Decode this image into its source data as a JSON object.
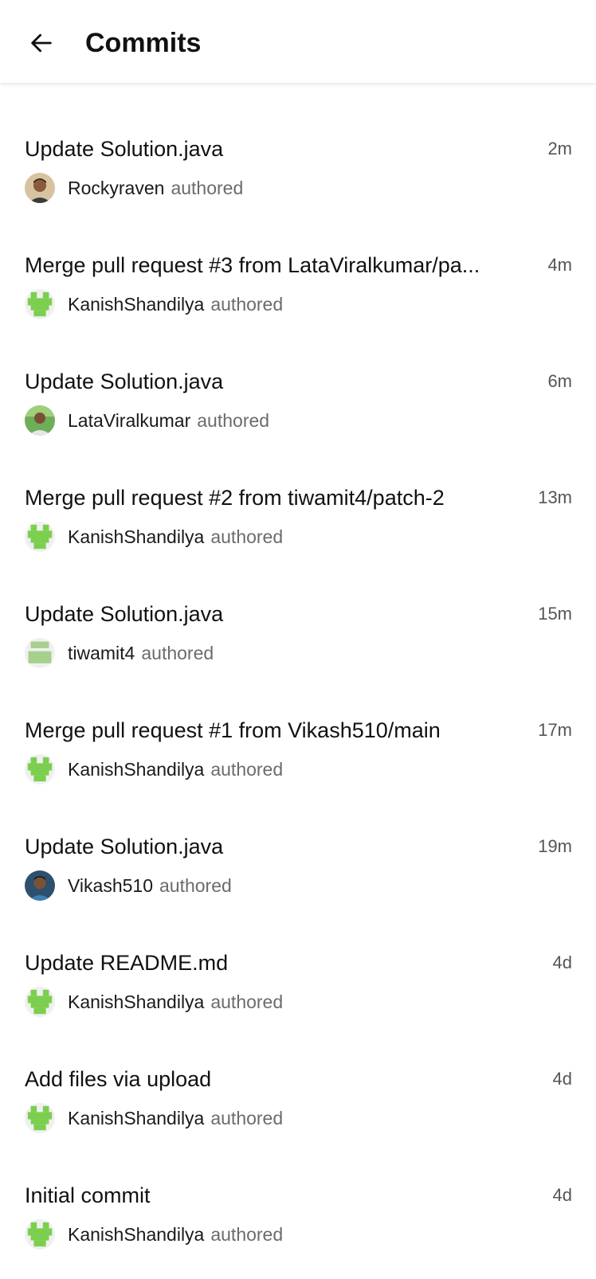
{
  "header": {
    "title": "Commits",
    "back_icon": "arrow-left-icon"
  },
  "colors": {
    "identicon_green": "#7ccf4e",
    "identicon_light_green": "#a7d08c",
    "text_primary": "#111111",
    "text_secondary": "#6b6b6b"
  },
  "commits": [
    {
      "message": "Update Solution.java",
      "time": "2m",
      "author": "Rockyraven",
      "verb": "authored",
      "avatar": "photo-beige"
    },
    {
      "message": "Merge pull request #3 from LataViralkumar/pa...",
      "time": "4m",
      "author": "KanishShandilya",
      "verb": "authored",
      "avatar": "identicon-green"
    },
    {
      "message": "Update Solution.java",
      "time": "6m",
      "author": "LataViralkumar",
      "verb": "authored",
      "avatar": "photo-green"
    },
    {
      "message": "Merge pull request #2 from tiwamit4/patch-2",
      "time": "13m",
      "author": "KanishShandilya",
      "verb": "authored",
      "avatar": "identicon-green"
    },
    {
      "message": "Update Solution.java",
      "time": "15m",
      "author": "tiwamit4",
      "verb": "authored",
      "avatar": "identicon-light-green"
    },
    {
      "message": "Merge pull request #1 from Vikash510/main",
      "time": "17m",
      "author": "KanishShandilya",
      "verb": "authored",
      "avatar": "identicon-green"
    },
    {
      "message": "Update Solution.java",
      "time": "19m",
      "author": "Vikash510",
      "verb": "authored",
      "avatar": "photo-blue"
    },
    {
      "message": "Update README.md",
      "time": "4d",
      "author": "KanishShandilya",
      "verb": "authored",
      "avatar": "identicon-green"
    },
    {
      "message": "Add files via upload",
      "time": "4d",
      "author": "KanishShandilya",
      "verb": "authored",
      "avatar": "identicon-green"
    },
    {
      "message": "Initial commit",
      "time": "4d",
      "author": "KanishShandilya",
      "verb": "authored",
      "avatar": "identicon-green"
    }
  ]
}
